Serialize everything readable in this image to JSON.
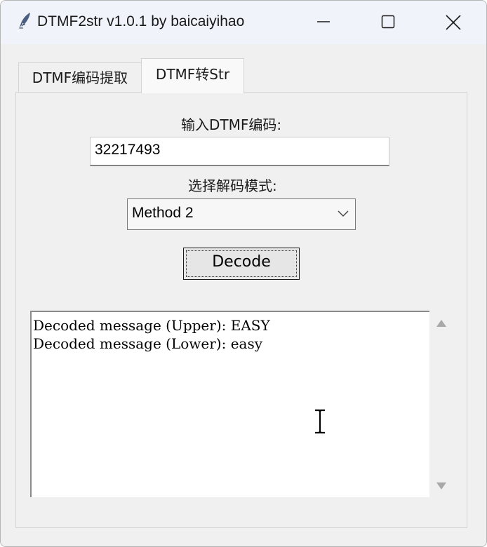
{
  "window": {
    "title": "DTMF2str v1.0.1 by baicaiyihao",
    "icon": "feather-icon",
    "controls": [
      "minimize-icon",
      "maximize-icon",
      "close-icon"
    ]
  },
  "tabs": [
    {
      "label": "DTMF编码提取",
      "selected": false
    },
    {
      "label": "DTMF转Str",
      "selected": true
    }
  ],
  "form": {
    "dtmf_label": "输入DTMF编码:",
    "dtmf_value": "32217493",
    "mode_label": "选择解码模式:",
    "mode_selected": "Method 2",
    "decode_button": "Decode"
  },
  "output": {
    "line_upper": "Decoded message (Upper): EASY",
    "line_lower": "Decoded message (Lower): easy"
  },
  "colors": {
    "window_bg": "#f0f0f0",
    "titlebar_bg": "#f0f3f9",
    "text_area_bg": "#ffffff"
  }
}
